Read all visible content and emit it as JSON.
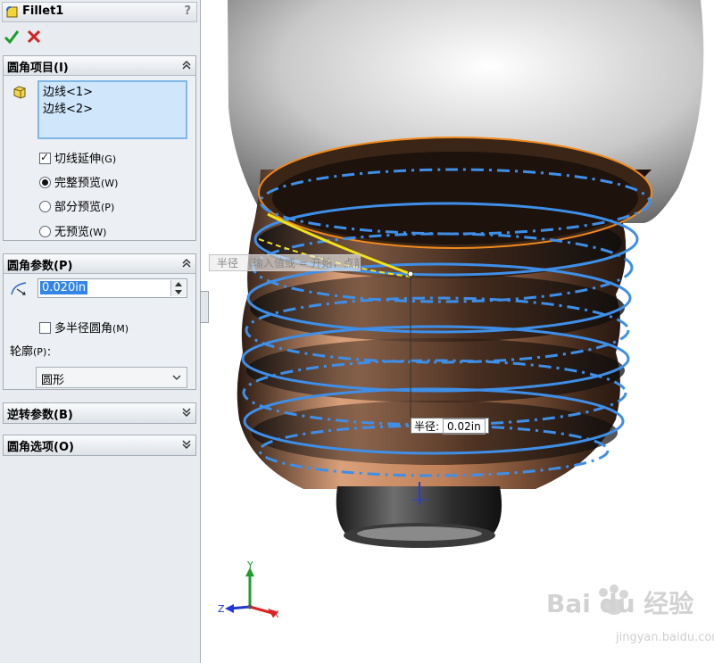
{
  "panel": {
    "title": "Fillet1",
    "help": "?",
    "groups": {
      "items": {
        "header": "圆角项目(I)",
        "edges": [
          "边线<1>",
          "边线<2>"
        ],
        "tangent_propagation": "切线延伸",
        "tangent_propagation_key": "(G)",
        "full_preview": "完整预览",
        "full_preview_key": "(W)",
        "partial_preview": "部分预览",
        "partial_preview_key": "(P)",
        "no_preview": "无预览",
        "no_preview_key": "(W)"
      },
      "params": {
        "header": "圆角参数(P)",
        "radius_value": "0.020in",
        "multi_radius": "多半径圆角",
        "multi_radius_key": "(M)",
        "profile_label": "轮廓",
        "profile_key": "(P)：",
        "profile_value": "圆形"
      },
      "setback": {
        "header": "逆转参数(B)"
      },
      "options": {
        "header": "圆角选项(O)"
      }
    }
  },
  "viewport": {
    "tooltip": "半径 （输入值或 = 开始，点箭头设置值",
    "callout_label": "半径:",
    "callout_value": "0.02in",
    "axes": {
      "x": "X",
      "y": "Y",
      "z": "Z"
    },
    "watermark": "Bai du 经验",
    "watermark_url": "jingyan.baidu.com"
  },
  "colors": {
    "edge_blue": "#3f8fe8",
    "selected_yellow": "#f2e21c",
    "thread_copper": "#c98a64",
    "orange_edge": "#f08a1e"
  }
}
